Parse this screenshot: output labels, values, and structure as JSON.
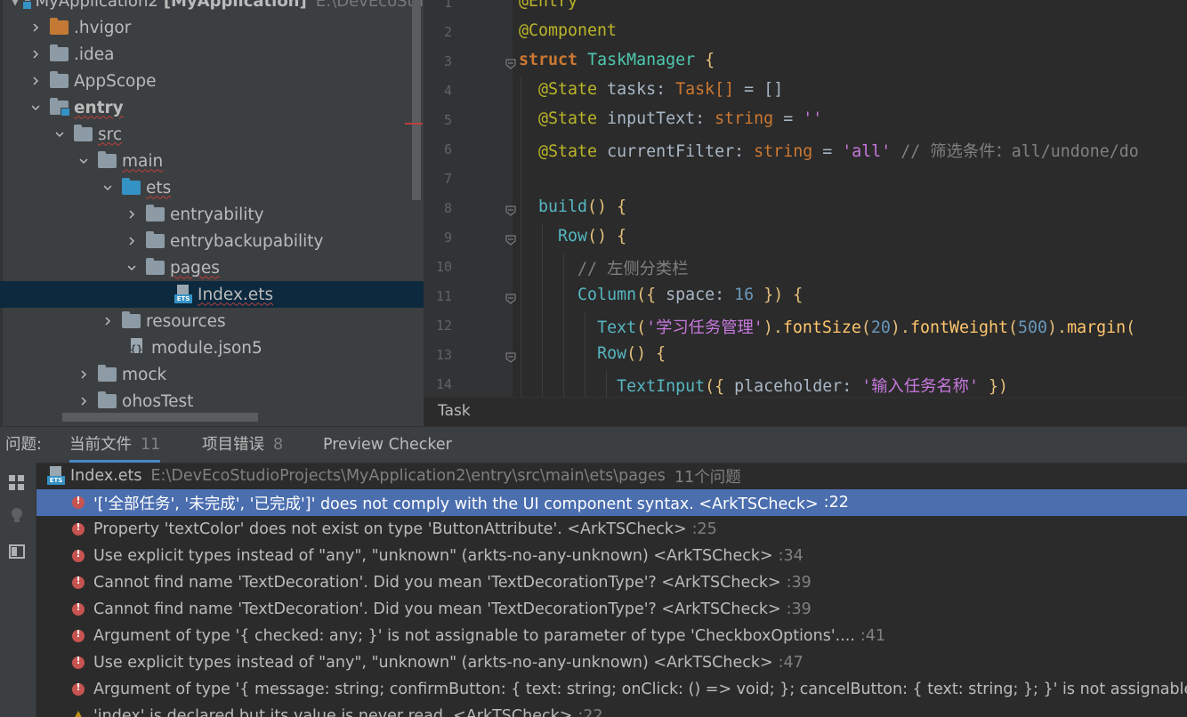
{
  "project": {
    "root_name": "MyApplication2",
    "root_module": "[MyApplication]",
    "root_path": "E:\\DevEcoStu",
    "items": [
      {
        "label": ".hvigor",
        "level": 1,
        "chevron": "right",
        "icon": "folder-orange"
      },
      {
        "label": ".idea",
        "level": 1,
        "chevron": "right",
        "icon": "folder-gray"
      },
      {
        "label": "AppScope",
        "level": 1,
        "chevron": "right",
        "icon": "folder-gray"
      },
      {
        "label": "entry",
        "level": 1,
        "chevron": "down",
        "icon": "folder-module"
      },
      {
        "label": "src",
        "level": 2,
        "chevron": "down",
        "icon": "folder-gray"
      },
      {
        "label": "main",
        "level": 3,
        "chevron": "down",
        "icon": "folder-gray"
      },
      {
        "label": "ets",
        "level": 4,
        "chevron": "down",
        "icon": "folder-blue"
      },
      {
        "label": "entryability",
        "level": 5,
        "chevron": "right",
        "icon": "folder-gray"
      },
      {
        "label": "entrybackupability",
        "level": 5,
        "chevron": "right",
        "icon": "folder-gray"
      },
      {
        "label": "pages",
        "level": 5,
        "chevron": "down",
        "icon": "folder-gray"
      },
      {
        "label": "Index.ets",
        "level": 6,
        "chevron": "none",
        "icon": "ets-file"
      },
      {
        "label": "resources",
        "level": 4,
        "chevron": "right",
        "icon": "folder-gray"
      },
      {
        "label": "module.json5",
        "level": 4,
        "chevron": "none",
        "icon": "json-file"
      },
      {
        "label": "mock",
        "level": 3,
        "chevron": "right",
        "icon": "folder-gray"
      },
      {
        "label": "ohosTest",
        "level": 3,
        "chevron": "right",
        "icon": "folder-gray"
      }
    ]
  },
  "editor": {
    "line_numbers": [
      "1",
      "2",
      "3",
      "4",
      "5",
      "6",
      "7",
      "8",
      "9",
      "10",
      "11",
      "12",
      "13",
      "14"
    ],
    "lines": {
      "l1_anno": "@Entry",
      "l2_anno": "@Component",
      "l3_kw": "struct",
      "l3_name": "TaskManager",
      "l3_brace": " {",
      "l4_anno": "@State",
      "l4_name": " tasks",
      "l4_colon": ": ",
      "l4_type": "Task[]",
      "l4_rest": " = []",
      "l5_anno": "@State",
      "l5_name": " inputText",
      "l5_colon": ": ",
      "l5_type": "string",
      "l5_eq": " = ",
      "l5_val": "''",
      "l6_anno": "@State",
      "l6_name": " currentFilter",
      "l6_colon": ": ",
      "l6_type": "string",
      "l6_eq": " = ",
      "l6_val": "'all'",
      "l6_comment": " // 筛选条件：all/undone/do",
      "l8_fn": "build",
      "l8_rest": "() {",
      "l9_fn": "Row",
      "l9_rest": "() {",
      "l10_comment": "// 左侧分类栏",
      "l11_fn": "Column",
      "l11_a": "({ ",
      "l11_prop": "space",
      "l11_b": ": ",
      "l11_num": "16",
      "l11_c": " }) {",
      "l12_fn": "Text",
      "l12_a": "(",
      "l12_str": "'学习任务管理'",
      "l12_b": ").",
      "l12_fn2": "fontSize",
      "l12_c": "(",
      "l12_num": "20",
      "l12_d": ").",
      "l12_fn3": "fontWeight",
      "l12_e": "(",
      "l12_num2": "500",
      "l12_f": ").",
      "l12_fn4": "margin",
      "l12_g": "(",
      "l13_fn": "Row",
      "l13_rest": "() {",
      "l14_fn": "TextInput",
      "l14_a": "({ ",
      "l14_prop": "placeholder",
      "l14_b": ": ",
      "l14_str": "'输入任务名称'",
      "l14_c": " })"
    }
  },
  "breadcrumb": "Task",
  "problems": {
    "title": "问题:",
    "tabs": [
      {
        "label": "当前文件",
        "count": "11"
      },
      {
        "label": "项目错误",
        "count": "8"
      },
      {
        "label": "Preview Checker",
        "count": ""
      }
    ],
    "file": {
      "name": "Index.ets",
      "path": "E:\\DevEcoStudioProjects\\MyApplication2\\entry\\src\\main\\ets\\pages",
      "count": "11个问题"
    },
    "items": [
      {
        "severity": "error",
        "message": "'['全部任务', '未完成', '已完成']' does not comply with the UI component syntax. <ArkTSCheck>",
        "line": ":22"
      },
      {
        "severity": "error",
        "message": "Property 'textColor' does not exist on type 'ButtonAttribute'. <ArkTSCheck>",
        "line": ":25"
      },
      {
        "severity": "error",
        "message": "Use explicit types instead of \"any\", \"unknown\" (arkts-no-any-unknown) <ArkTSCheck>",
        "line": ":34"
      },
      {
        "severity": "error",
        "message": "Cannot find name 'TextDecoration'. Did you mean 'TextDecorationType'? <ArkTSCheck>",
        "line": ":39"
      },
      {
        "severity": "error",
        "message": "Cannot find name 'TextDecoration'. Did you mean 'TextDecorationType'? <ArkTSCheck>",
        "line": ":39"
      },
      {
        "severity": "error",
        "message": "Argument of type '{ checked: any; }' is not assignable to parameter of type 'CheckboxOptions'....",
        "line": ":41"
      },
      {
        "severity": "error",
        "message": "Use explicit types instead of \"any\", \"unknown\" (arkts-no-any-unknown) <ArkTSCheck>",
        "line": ":47"
      },
      {
        "severity": "error",
        "message": "Argument of type '{ message: string; confirmButton: { text: string; onClick: () => void; }; cancelButton: { text: string; }; }' is not assignable to param",
        "line": ""
      },
      {
        "severity": "warning",
        "message": "'index' is declared but its value is never read. <ArkTSCheck>",
        "line": ":22"
      }
    ]
  },
  "colors": {
    "selection": "#4b6eaf",
    "error": "#c75450",
    "warning": "#be9117",
    "tree_selection": "#0d293e"
  }
}
